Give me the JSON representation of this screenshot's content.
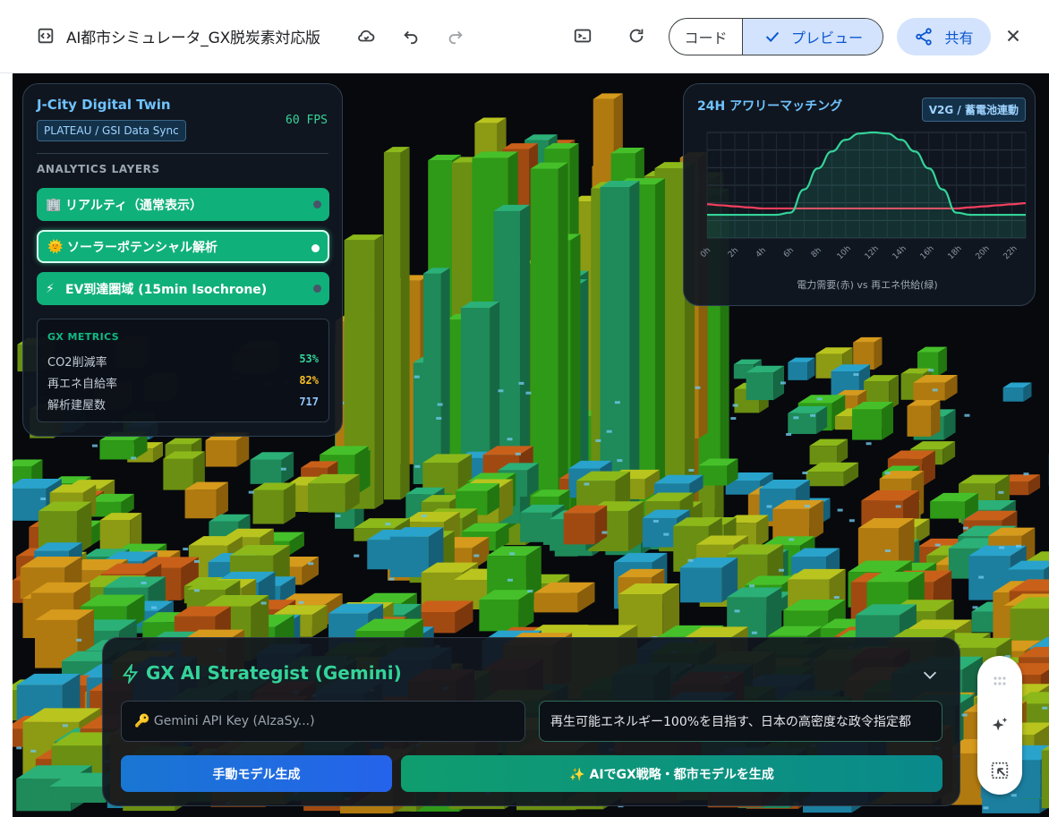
{
  "topbar": {
    "title": "AI都市シミュレータ_GX脱炭素対応版",
    "code_label": "コード",
    "preview_label": "プレビュー",
    "share_label": "共有",
    "icons": [
      "code-bracket-icon",
      "cloud-sync-icon",
      "undo-icon",
      "redo-icon",
      "terminal-icon",
      "refresh-icon",
      "check-icon",
      "share-icon",
      "close-icon"
    ]
  },
  "twin": {
    "title": "J-City Digital Twin",
    "badge": "PLATEAU / GSI Data Sync",
    "fps": "60 FPS",
    "layers_heading": "ANALYTICS LAYERS",
    "layers": [
      {
        "icon": "🏢",
        "label": "リアルティ（通常表示）",
        "active": false
      },
      {
        "icon": "🌞",
        "label": "ソーラーポテンシャル解析",
        "active": true
      },
      {
        "icon": "⚡",
        "label": "EV到達圏域 (15min Isochrone)",
        "active": false
      }
    ],
    "metrics": {
      "heading": "GX METRICS",
      "rows": [
        {
          "label": "CO2削減率",
          "value": "53%",
          "color": "#34d399"
        },
        {
          "label": "再エネ自給率",
          "value": "82%",
          "color": "#fbbf24"
        },
        {
          "label": "解析建屋数",
          "value": "717",
          "color": "#93c5fd"
        }
      ]
    }
  },
  "matching": {
    "title": "24H アワリーマッチング",
    "badge": "V2G / 蓄電池連動",
    "caption": "電力需要(赤) vs 再エネ供給(緑)"
  },
  "chart_data": {
    "type": "line",
    "x": [
      0,
      1,
      2,
      3,
      4,
      5,
      6,
      7,
      8,
      9,
      10,
      11,
      12,
      13,
      14,
      15,
      16,
      17,
      18,
      19,
      20,
      21,
      22,
      23
    ],
    "xticks": [
      "0h",
      "2h",
      "4h",
      "6h",
      "8h",
      "10h",
      "12h",
      "14h",
      "16h",
      "18h",
      "20h",
      "22h"
    ],
    "ylim": [
      0,
      100
    ],
    "grid": true,
    "series": [
      {
        "name": "電力需要",
        "color": "#f43f5e",
        "values": [
          32,
          31,
          30,
          29,
          28,
          28,
          28,
          28,
          28,
          28,
          28,
          28,
          28,
          28,
          28,
          28,
          28,
          28,
          28,
          29,
          30,
          31,
          32,
          33
        ]
      },
      {
        "name": "再エネ供給",
        "color": "#34d399",
        "values": [
          22,
          22,
          22,
          22,
          22,
          22,
          24,
          46,
          66,
          82,
          93,
          99,
          100,
          99,
          93,
          82,
          66,
          46,
          24,
          22,
          22,
          22,
          22,
          22
        ]
      }
    ]
  },
  "strategist": {
    "title": "GX AI Strategist (Gemini)",
    "api_placeholder": "🔑 Gemini API Key (AIzaSy...)",
    "prompt_value": "再生可能エネルギー100%を目指す、日本の高密度な政令指定都",
    "manual_button": "手動モデル生成",
    "ai_button": "✨ AIでGX戦略・都市モデルを生成"
  },
  "float_tools": {
    "icons": [
      "grip-dots-icon",
      "sparkle-icon",
      "select-region-icon"
    ]
  },
  "colors": {
    "accent_green": "#10b981",
    "accent_blue": "#60a5fa",
    "panel_bg": "#111821",
    "preview_tint": "#d3e3fd"
  }
}
